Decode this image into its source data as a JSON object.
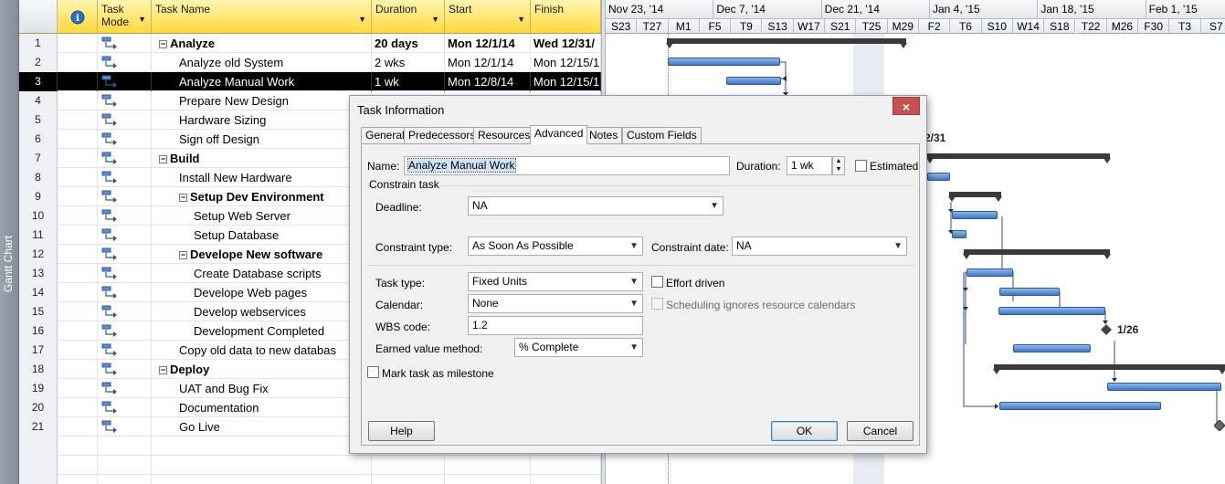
{
  "viewbar": {
    "label": "Gantt Chart"
  },
  "columns": {
    "info": "i",
    "mode": "Task Mode",
    "name": "Task Name",
    "duration": "Duration",
    "start": "Start",
    "finish": "Finish"
  },
  "tasks": [
    {
      "id": "1",
      "name": "Analyze",
      "duration": "20 days",
      "start": "Mon 12/1/14",
      "finish": "Wed 12/31/",
      "summary": true,
      "indent": 0
    },
    {
      "id": "2",
      "name": "Analyze old System",
      "duration": "2 wks",
      "start": "Mon 12/1/14",
      "finish": "Mon 12/15/1",
      "summary": false,
      "indent": 1
    },
    {
      "id": "3",
      "name": "Analyze Manual Work",
      "duration": "1 wk",
      "start": "Mon 12/8/14",
      "finish": "Mon 12/15/1",
      "summary": false,
      "indent": 1,
      "selected": true
    },
    {
      "id": "4",
      "name": "Prepare New Design",
      "duration": "",
      "start": "",
      "finish": "",
      "summary": false,
      "indent": 1
    },
    {
      "id": "5",
      "name": "Hardware Sizing",
      "duration": "",
      "start": "",
      "finish": "",
      "summary": false,
      "indent": 1
    },
    {
      "id": "6",
      "name": "Sign off Design",
      "duration": "",
      "start": "",
      "finish": "",
      "summary": false,
      "indent": 1
    },
    {
      "id": "7",
      "name": "Build",
      "duration": "",
      "start": "",
      "finish": "",
      "summary": true,
      "indent": 0
    },
    {
      "id": "8",
      "name": "Install New Hardware",
      "duration": "",
      "start": "",
      "finish": "",
      "summary": false,
      "indent": 1
    },
    {
      "id": "9",
      "name": "Setup Dev Environment",
      "duration": "",
      "start": "",
      "finish": "",
      "summary": true,
      "indent": 1
    },
    {
      "id": "10",
      "name": "Setup Web Server",
      "duration": "",
      "start": "",
      "finish": "",
      "summary": false,
      "indent": 2
    },
    {
      "id": "11",
      "name": "Setup Database",
      "duration": "",
      "start": "",
      "finish": "",
      "summary": false,
      "indent": 2
    },
    {
      "id": "12",
      "name": "Develope New software",
      "duration": "",
      "start": "",
      "finish": "",
      "summary": true,
      "indent": 1
    },
    {
      "id": "13",
      "name": "Create Database scripts",
      "duration": "",
      "start": "",
      "finish": "",
      "summary": false,
      "indent": 2
    },
    {
      "id": "14",
      "name": "Develope Web pages",
      "duration": "",
      "start": "",
      "finish": "",
      "summary": false,
      "indent": 2
    },
    {
      "id": "15",
      "name": "Develop webservices",
      "duration": "",
      "start": "",
      "finish": "",
      "summary": false,
      "indent": 2
    },
    {
      "id": "16",
      "name": "Development Completed",
      "duration": "",
      "start": "",
      "finish": "",
      "summary": false,
      "indent": 2
    },
    {
      "id": "17",
      "name": "Copy old data to new databas",
      "duration": "",
      "start": "",
      "finish": "",
      "summary": false,
      "indent": 1
    },
    {
      "id": "18",
      "name": "Deploy",
      "duration": "",
      "start": "",
      "finish": "",
      "summary": true,
      "indent": 0
    },
    {
      "id": "19",
      "name": "UAT and Bug Fix",
      "duration": "",
      "start": "",
      "finish": "",
      "summary": false,
      "indent": 1
    },
    {
      "id": "20",
      "name": "Documentation",
      "duration": "",
      "start": "",
      "finish": "",
      "summary": false,
      "indent": 1
    },
    {
      "id": "21",
      "name": "Go Live",
      "duration": "",
      "start": "",
      "finish": "",
      "summary": false,
      "indent": 1
    }
  ],
  "timescale": {
    "weeks": [
      "Nov 23, '14",
      "Dec 7, '14",
      "Dec 21, '14",
      "Jan 4, '15",
      "Jan 18, '15",
      "Feb 1, '15"
    ],
    "days": [
      "S23",
      "T27",
      "M1",
      "F5",
      "T9",
      "S13",
      "W17",
      "S21",
      "T25",
      "M29",
      "F2",
      "T6",
      "S10",
      "W14",
      "S18",
      "T22",
      "M26",
      "F30",
      "T3",
      "S7"
    ],
    "annotations": [
      "2/31",
      "1/26"
    ]
  },
  "dialog": {
    "title": "Task Information",
    "close": "×",
    "tabs": [
      "General",
      "Predecessors",
      "Resources",
      "Advanced",
      "Notes",
      "Custom Fields"
    ],
    "active_tab": "Advanced",
    "name_label": "Name:",
    "name_value": "Analyze Manual Work",
    "duration_label": "Duration:",
    "duration_value": "1 wk",
    "estimated_label": "Estimated",
    "constrain_group": "Constrain task",
    "deadline_label": "Deadline:",
    "deadline_value": "NA",
    "constraint_type_label": "Constraint type:",
    "constraint_type_value": "As Soon As Possible",
    "constraint_date_label": "Constraint date:",
    "constraint_date_value": "NA",
    "task_type_label": "Task type:",
    "task_type_value": "Fixed Units",
    "effort_driven_label": "Effort driven",
    "calendar_label": "Calendar:",
    "calendar_value": "None",
    "sched_ignores_label": "Scheduling ignores resource calendars",
    "wbs_label": "WBS code:",
    "wbs_value": "1.2",
    "earned_value_label": "Earned value method:",
    "earned_value_value": "% Complete",
    "milestone_label": "Mark task as milestone",
    "help_button": "Help",
    "ok_button": "OK",
    "cancel_button": "Cancel"
  },
  "colors": {
    "header_gold": "#ffd83a",
    "bar_blue": "#3d78c8",
    "close_red": "#c75050"
  }
}
